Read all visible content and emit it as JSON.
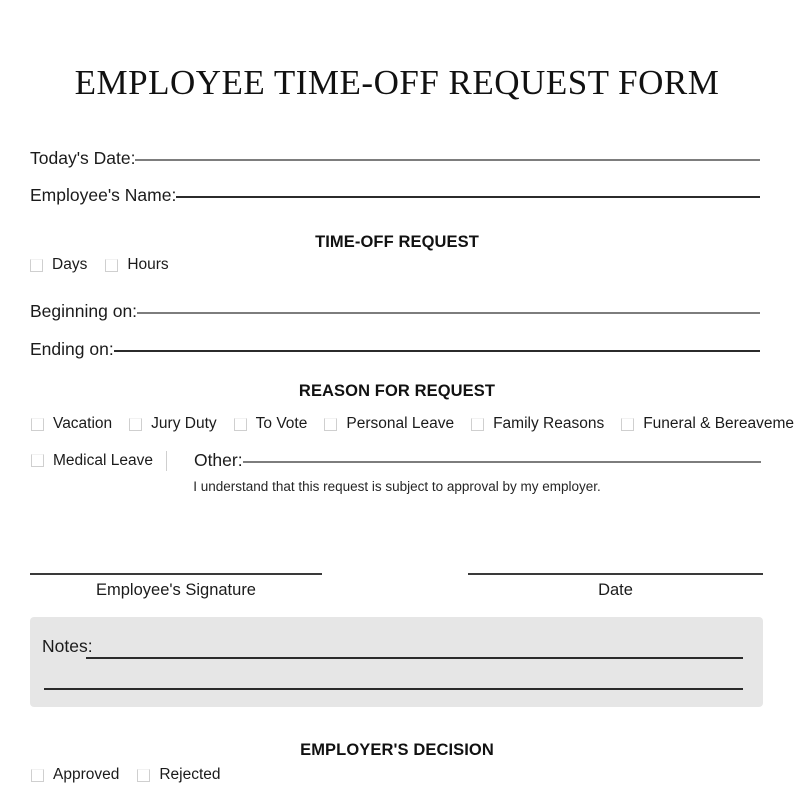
{
  "document": {
    "title": "EMPLOYEE TIME-OFF REQUEST FORM"
  },
  "fields": {
    "todays_date": {
      "label": "Today's Date:",
      "value": ""
    },
    "employee_name": {
      "label": "Employee's Name:",
      "value": ""
    },
    "beginning_on": {
      "label": "Beginning on:",
      "value": ""
    },
    "ending_on": {
      "label": "Ending on:",
      "value": ""
    },
    "other": {
      "label": "Other:",
      "value": ""
    },
    "notes": {
      "label": "Notes:",
      "value": ""
    }
  },
  "sections": {
    "time_off_request": {
      "heading": "TIME-OFF REQUEST",
      "duration_options": [
        {
          "label": "Days",
          "checked": false
        },
        {
          "label": "Hours",
          "checked": false
        }
      ]
    },
    "reason_for_request": {
      "heading": "REASON FOR REQUEST",
      "options_row_1": [
        {
          "label": "Vacation",
          "checked": false
        },
        {
          "label": "Jury Duty",
          "checked": false
        },
        {
          "label": "To Vote",
          "checked": false
        },
        {
          "label": "Personal Leave",
          "checked": false
        },
        {
          "label": "Family Reasons",
          "checked": false
        },
        {
          "label": "Funeral & Bereavement",
          "checked": false
        }
      ],
      "options_row_2": [
        {
          "label": "Medical Leave",
          "checked": false
        }
      ]
    },
    "employer_decision": {
      "heading": "EMPLOYER'S DECISION",
      "options": [
        {
          "label": "Approved",
          "checked": false
        },
        {
          "label": "Rejected",
          "checked": false
        }
      ]
    }
  },
  "disclaimer": "I understand that this request is subject to approval by my employer.",
  "signature": {
    "employee_signature_caption": "Employee's Signature",
    "date_caption": "Date"
  },
  "colors": {
    "page_background": "#ffffff",
    "text": "#1a1a1a",
    "rule_dark": "#2b2b2b",
    "rule_light": "#7d7d7d",
    "notes_background": "#e6e6e6",
    "checkbox_border": "#cfcfcf"
  }
}
